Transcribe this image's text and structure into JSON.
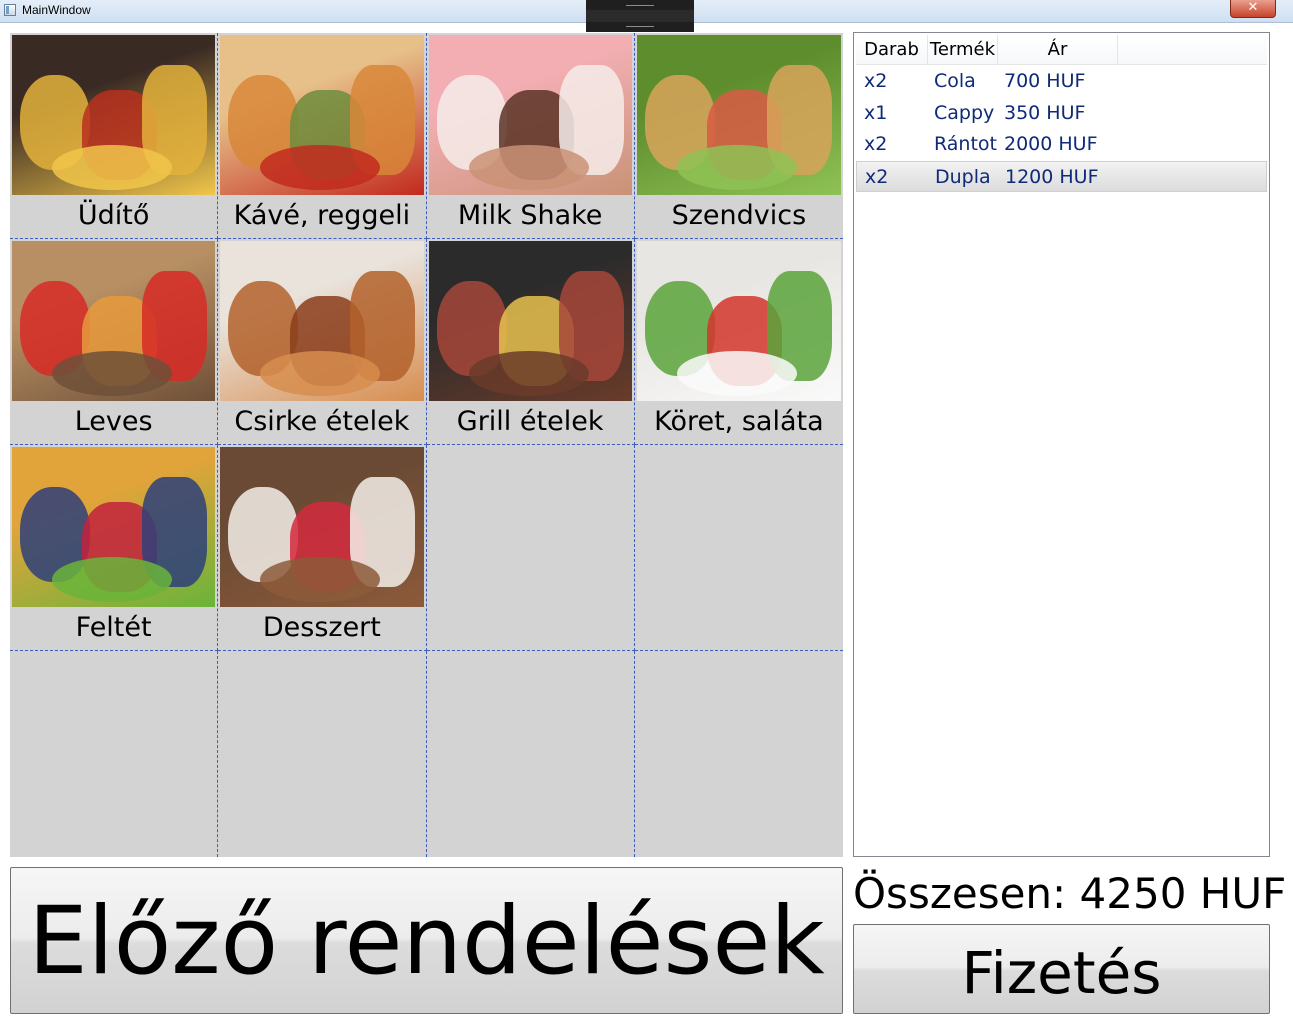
{
  "window": {
    "title": "MainWindow"
  },
  "categories": [
    {
      "label": "Üdítő",
      "icon": "soft-drinks-photo",
      "colors": [
        "#3a2a24",
        "#e3b23c",
        "#b8301f",
        "#f1c64a"
      ]
    },
    {
      "label": "Kávé, reggeli",
      "icon": "coffee-breakfast-photo",
      "colors": [
        "#e7c089",
        "#d8873a",
        "#6d8d3c",
        "#c22a1e"
      ]
    },
    {
      "label": "Milk Shake",
      "icon": "milkshake-photo",
      "colors": [
        "#f2aeb2",
        "#f6ecea",
        "#5b3325",
        "#c99276"
      ]
    },
    {
      "label": "Szendvics",
      "icon": "sandwich-photo",
      "colors": [
        "#5e8d2d",
        "#d8a35b",
        "#d85a44",
        "#8fc255"
      ]
    },
    {
      "label": "Leves",
      "icon": "soup-photo",
      "colors": [
        "#b78f63",
        "#d72a26",
        "#e89a3c",
        "#6f5038"
      ]
    },
    {
      "label": "Csirke ételek",
      "icon": "chicken-photo",
      "colors": [
        "#e9e3dc",
        "#b3612b",
        "#8a3d1b",
        "#d78d4e"
      ]
    },
    {
      "label": "Grill ételek",
      "icon": "grill-photo",
      "colors": [
        "#2b2b2b",
        "#a6463a",
        "#e6c14e",
        "#6a3b2a"
      ]
    },
    {
      "label": "Köret, saláta",
      "icon": "salad-photo",
      "colors": [
        "#e8e6e2",
        "#5aa33b",
        "#d2352b",
        "#fafafa"
      ]
    },
    {
      "label": "Feltét",
      "icon": "berries-photo",
      "colors": [
        "#e0a43a",
        "#2e3f7a",
        "#c3213d",
        "#6ab43a"
      ]
    },
    {
      "label": "Desszert",
      "icon": "dessert-photo",
      "colors": [
        "#6a4a34",
        "#f3eee9",
        "#d42a3e",
        "#8c5a3a"
      ]
    }
  ],
  "order_list": {
    "columns": [
      "Darab",
      "Termék",
      "Ár"
    ],
    "rows": [
      {
        "qty": "x2",
        "product": "Cola",
        "price": "700 HUF"
      },
      {
        "qty": "x1",
        "product": "Cappy",
        "price": "350 HUF"
      },
      {
        "qty": "x2",
        "product": "Rántot",
        "price": "2000 HUF"
      },
      {
        "qty": "x2",
        "product": "Dupla",
        "price": "1200 HUF"
      }
    ],
    "selected_index": 3
  },
  "total": {
    "text": "Összesen: 4250 HUF"
  },
  "buttons": {
    "previous_orders": "Előző rendelések",
    "pay": "Fizetés"
  }
}
